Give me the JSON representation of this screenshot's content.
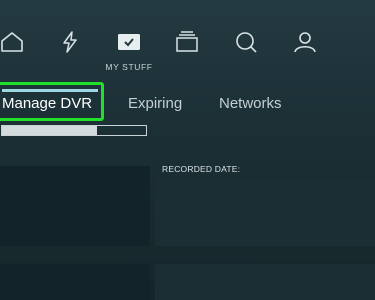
{
  "nav": {
    "icons": [
      "home-icon",
      "lightning-icon",
      "my-stuff-checkbox-icon",
      "stack-icon",
      "search-icon",
      "profile-icon"
    ],
    "my_stuff_label": "MY STUFF"
  },
  "tabs": [
    {
      "label": "Manage DVR",
      "active": true
    },
    {
      "label": "Expiring",
      "active": false
    },
    {
      "label": "Networks",
      "active": false
    }
  ],
  "storage": {
    "used_fraction": 0.66
  },
  "list": {
    "recorded_date_label": "RECORDED DATE:"
  },
  "colors": {
    "highlight": "#22e02a",
    "accent": "#9dd7e0"
  }
}
